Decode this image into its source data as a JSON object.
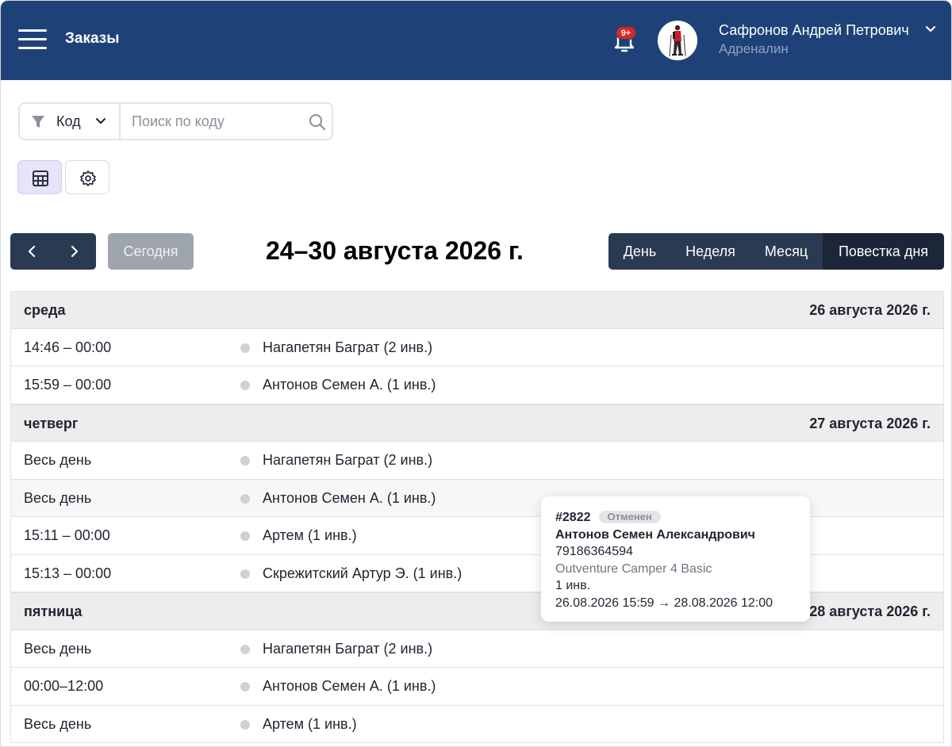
{
  "header": {
    "title": "Заказы",
    "notifications_badge": "9+",
    "user_name": "Сафронов Андрей Петрович",
    "user_org": "Адреналин"
  },
  "search": {
    "filter_label": "Код",
    "placeholder": "Поиск по коду"
  },
  "calendar": {
    "today_label": "Сегодня",
    "range_title": "24–30 августа 2026 г.",
    "views": [
      "День",
      "Неделя",
      "Месяц",
      "Повестка дня"
    ],
    "active_view": "Повестка дня"
  },
  "agenda": {
    "days": [
      {
        "name": "среда",
        "date": "26 августа 2026 г.",
        "events": [
          {
            "time": "14:46 – 00:00",
            "title": "Нагапетян Баграт (2 инв.)"
          },
          {
            "time": "15:59 – 00:00",
            "title": "Антонов Семен А. (1 инв.)"
          }
        ]
      },
      {
        "name": "четверг",
        "date": "27 августа 2026 г.",
        "events": [
          {
            "time": "Весь день",
            "title": "Нагапетян Баграт (2 инв.)"
          },
          {
            "time": "Весь день",
            "title": "Антонов Семен А. (1 инв.)"
          },
          {
            "time": "15:11 – 00:00",
            "title": "Артем (1 инв.)"
          },
          {
            "time": "15:13 – 00:00",
            "title": "Скрежитский Артур Э. (1 инв.)"
          }
        ]
      },
      {
        "name": "пятница",
        "date": "28 августа 2026 г.",
        "events": [
          {
            "time": "Весь день",
            "title": "Нагапетян Баграт (2 инв.)"
          },
          {
            "time": "00:00–12:00",
            "title": "Антонов Семен А. (1 инв.)"
          },
          {
            "time": "Весь день",
            "title": "Артем (1 инв.)"
          }
        ]
      }
    ]
  },
  "tooltip": {
    "number": "#2822",
    "status": "Отменен",
    "customer": "Антонов Семен Александрович",
    "phone": "79186364594",
    "item": "Outventure Camper 4 Basic",
    "quantity": "1 инв.",
    "period": "26.08.2026 15:59 → 28.08.2026 12:00"
  }
}
